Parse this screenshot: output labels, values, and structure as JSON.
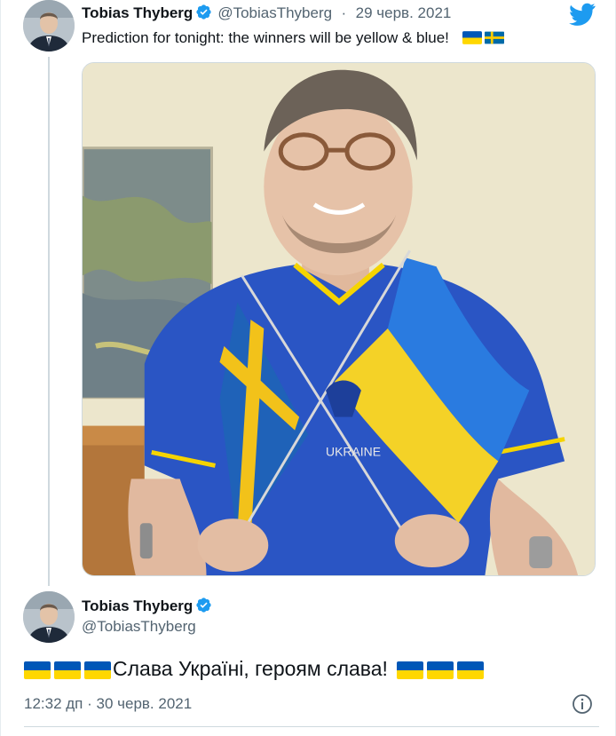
{
  "quoted_tweet": {
    "author_name": "Tobias Thyberg",
    "handle": "@TobiasThyberg",
    "separator": "·",
    "date": "29 черв. 2021",
    "text": "Prediction for tonight: the winners will be yellow & blue!",
    "flags": [
      "ukraine-flag",
      "sweden-flag"
    ],
    "media": {
      "description_icon": "photo",
      "shirt_text": "UKRAINE"
    }
  },
  "main_tweet": {
    "author_name": "Tobias Thyberg",
    "handle": "@TobiasThyberg",
    "text": "Слава Україні, героям слава!",
    "leading_flags": [
      "ukraine-flag",
      "ukraine-flag",
      "ukraine-flag"
    ],
    "trailing_flags": [
      "ukraine-flag",
      "ukraine-flag",
      "ukraine-flag"
    ],
    "timestamp": "12:32 дп · 30 черв. 2021"
  },
  "icons": {
    "brand": "twitter-bird-icon",
    "verified": "verified-badge-icon",
    "info": "info-icon"
  },
  "colors": {
    "twitter_blue": "#1d9bf0",
    "ukraine_blue": "#0057b7",
    "ukraine_yellow": "#ffd700",
    "sweden_blue": "#006aa7",
    "sweden_yellow": "#fecc00",
    "muted_text": "#536471"
  }
}
